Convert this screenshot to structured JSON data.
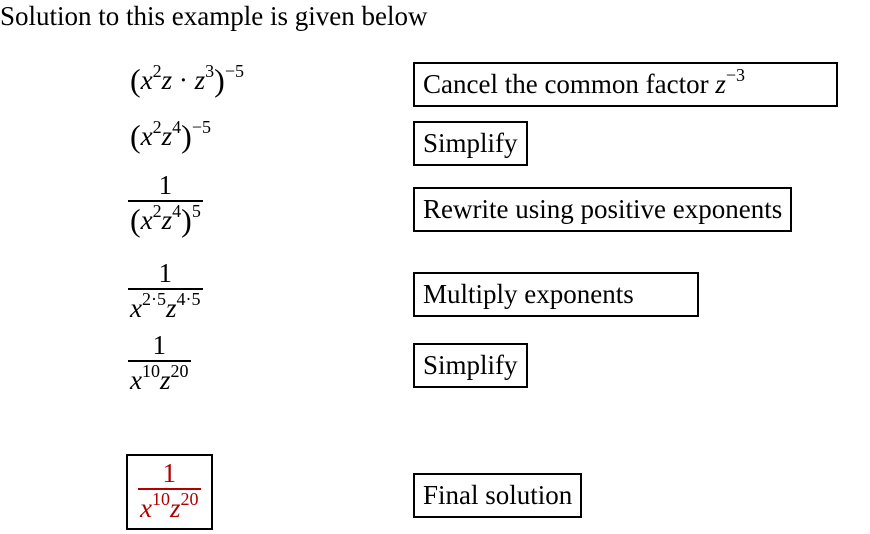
{
  "intro": "Solution to this example is given below",
  "steps": [
    {
      "expr": {
        "base_x": "x",
        "exp_x": "2",
        "z1": "z",
        "dot": "·",
        "z2": "z",
        "exp_z2": "3",
        "outer_exp": "−5"
      },
      "note": {
        "text": "Cancel the common factor ",
        "var": "z",
        "exp": "−3"
      }
    },
    {
      "expr": {
        "base_x": "x",
        "exp_x": "2",
        "z": "z",
        "exp_z": "4",
        "outer_exp": "−5"
      },
      "note": {
        "text": "Simplify"
      }
    },
    {
      "expr": {
        "num": "1",
        "x": "x",
        "exp_x": "2",
        "z": "z",
        "exp_z": "4",
        "outer_exp": "5"
      },
      "note": {
        "text": "Rewrite using positive exponents"
      }
    },
    {
      "expr": {
        "num": "1",
        "x": "x",
        "exp_x": "2·5",
        "z": "z",
        "exp_z": "4·5"
      },
      "note": {
        "text": "Multiply exponents"
      }
    },
    {
      "expr": {
        "num": "1",
        "x": "x",
        "exp_x": "10",
        "z": "z",
        "exp_z": "20"
      },
      "note": {
        "text": "Simplify"
      }
    }
  ],
  "final": {
    "expr": {
      "num": "1",
      "x": "x",
      "exp_x": "10",
      "z": "z",
      "exp_z": "20"
    },
    "note": {
      "text": "Final solution"
    },
    "color": "#b00000"
  }
}
